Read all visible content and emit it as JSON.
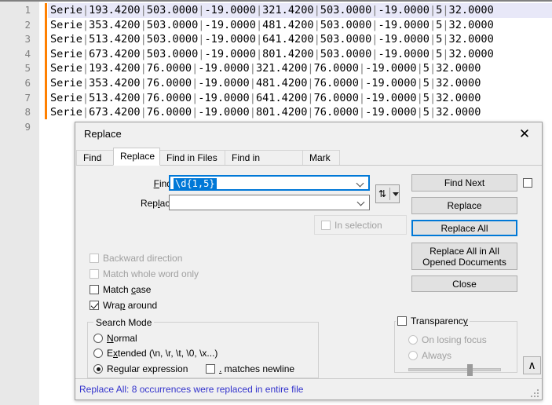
{
  "editor": {
    "lines": [
      {
        "num": "1",
        "text": "Serie|193.4200|503.0000|-19.0000|321.4200|503.0000|-19.0000|5|32.0000",
        "current": true
      },
      {
        "num": "2",
        "text": "Serie|353.4200|503.0000|-19.0000|481.4200|503.0000|-19.0000|5|32.0000",
        "current": false
      },
      {
        "num": "3",
        "text": "Serie|513.4200|503.0000|-19.0000|641.4200|503.0000|-19.0000|5|32.0000",
        "current": false
      },
      {
        "num": "4",
        "text": "Serie|673.4200|503.0000|-19.0000|801.4200|503.0000|-19.0000|5|32.0000",
        "current": false
      },
      {
        "num": "5",
        "text": "Serie|193.4200|76.0000|-19.0000|321.4200|76.0000|-19.0000|5|32.0000",
        "current": false
      },
      {
        "num": "6",
        "text": "Serie|353.4200|76.0000|-19.0000|481.4200|76.0000|-19.0000|5|32.0000",
        "current": false
      },
      {
        "num": "7",
        "text": "Serie|513.4200|76.0000|-19.0000|641.4200|76.0000|-19.0000|5|32.0000",
        "current": false
      },
      {
        "num": "8",
        "text": "Serie|673.4200|76.0000|-19.0000|801.4200|76.0000|-19.0000|5|32.0000",
        "current": false
      },
      {
        "num": "9",
        "text": "",
        "current": false
      }
    ]
  },
  "dialog": {
    "title": "Replace",
    "close_label": "✕",
    "tabs": [
      {
        "label": "Find",
        "active": false
      },
      {
        "label": "Replace",
        "active": true
      },
      {
        "label": "Find in Files",
        "active": false
      },
      {
        "label": "Find in Projects",
        "active": false
      },
      {
        "label": "Mark",
        "active": false
      }
    ],
    "fields": {
      "find_label": "Find what:",
      "find_value": "\\d{1,5}",
      "find_placeholder": "",
      "replace_label": "Replace with:",
      "replace_value": "",
      "replace_placeholder": "",
      "swap_icon": "⇅"
    },
    "buttons": {
      "find_next": "Find Next",
      "replace": "Replace",
      "replace_all": "Replace All",
      "replace_all_opened": "Replace All in All Opened Documents",
      "close": "Close",
      "up_arrow": "∧"
    },
    "options": {
      "in_selection": {
        "label": "In selection",
        "checked": false,
        "disabled": true
      },
      "keep_open": {
        "label": "",
        "checked": false,
        "disabled": false
      },
      "backward_direction": {
        "label": "Backward direction",
        "checked": false,
        "disabled": true
      },
      "match_whole_word": {
        "label": "Match whole word only",
        "checked": false,
        "disabled": true
      },
      "match_case": {
        "label": "Match case",
        "checked": false,
        "disabled": false
      },
      "wrap_around": {
        "label": "Wrap around",
        "checked": true,
        "disabled": false
      }
    },
    "search_mode": {
      "group_label": "Search Mode",
      "normal": {
        "label": "Normal",
        "selected": false
      },
      "extended": {
        "label": "Extended (\\n, \\r, \\t, \\0, \\x...)",
        "selected": false
      },
      "regex": {
        "label": "Regular expression",
        "selected": true
      },
      "dot_matches_newline": {
        "label": ". matches newline",
        "checked": false
      }
    },
    "transparency": {
      "group_label": "Transparency",
      "enabled": false,
      "on_losing_focus": {
        "label": "On losing focus",
        "selected": false,
        "disabled": true
      },
      "always": {
        "label": "Always",
        "selected": false,
        "disabled": true
      },
      "slider_position_pct": 66
    },
    "status": {
      "message": "Replace All: 8 occurrences were replaced in entire file",
      "color": "#3333cc"
    }
  },
  "colors": {
    "accent": "#0078d7",
    "marker": "#ff8000",
    "current_line": "#e8e8f8",
    "dialog_bg": "#f0f0f0",
    "status_text": "#3333cc"
  }
}
